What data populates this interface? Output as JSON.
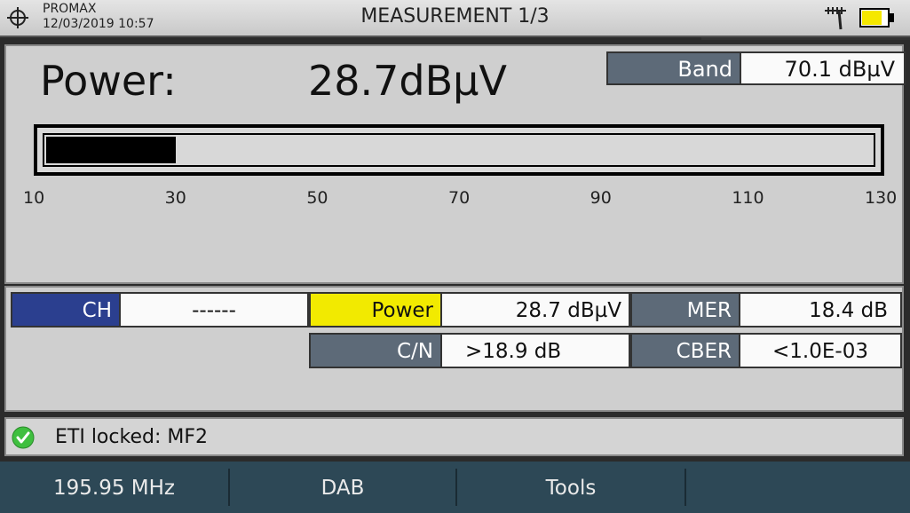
{
  "header": {
    "brand": "PROMAX",
    "datetime": "12/03/2019 10:57",
    "title": "MEASUREMENT 1/3",
    "icons": [
      "crosshair-icon",
      "antenna-icon",
      "battery-icon"
    ],
    "battery_level": 0.72
  },
  "power": {
    "label": "Power:",
    "value": "28.7dBµV",
    "band_label": "Band",
    "band_value": "70.1  dBµV",
    "bar_fill_value": 28.7,
    "scale_min": 10,
    "scale_max": 130,
    "scale_ticks": [
      "10",
      "30",
      "50",
      "70",
      "90",
      "110",
      "130"
    ]
  },
  "grid": {
    "ch_label": "CH",
    "ch_value": "------",
    "power_label": "Power",
    "power_value": "28.7  dBµV",
    "mer_label": "MER",
    "mer_value": "18.4  dB",
    "cn_label": "C/N",
    "cn_value": ">18.9  dB",
    "cber_label": "CBER",
    "cber_value": "<1.0E-03"
  },
  "status": {
    "text": "ETI locked: MF2",
    "icon": "check-circle-icon"
  },
  "footer": {
    "keys": [
      "195.95 MHz",
      "DAB",
      "Tools",
      ""
    ]
  },
  "colors": {
    "ch_label_bg": "#2b3f8f",
    "power_label_bg": "#f2ea00",
    "label_bg": "#5d6a78",
    "footer_bg": "#2d4856",
    "ok_green": "#3fbf3f",
    "battery": "#f5e800"
  }
}
